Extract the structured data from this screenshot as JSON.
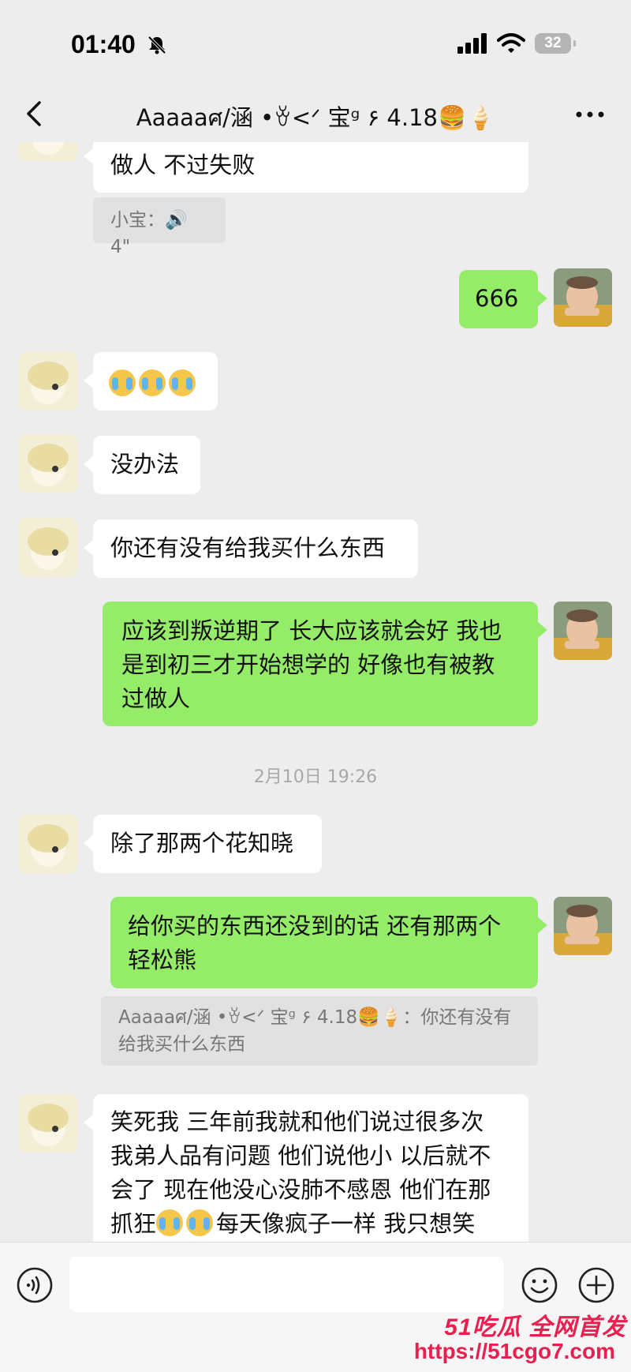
{
  "status_bar": {
    "time": "01:40",
    "battery": "32"
  },
  "header": {
    "title": "Aaaaaศ/涵 •ꈊ<ᐟ 宝ᵍ ۶ 4.18🍔🍦"
  },
  "messages": [
    {
      "dir": "in",
      "text": "做人 不过失败"
    },
    {
      "dir": "quote",
      "text": "小宝：🔊 4\""
    },
    {
      "dir": "out",
      "text": "666"
    },
    {
      "dir": "in",
      "emoji": [
        "crying-emoji",
        "crying-emoji",
        "crying-emoji"
      ]
    },
    {
      "dir": "in",
      "text": "没办法"
    },
    {
      "dir": "in",
      "text": "你还有没有给我买什么东西"
    },
    {
      "dir": "out",
      "lines": [
        "应该到叛逆期了 长大应该就会好 我也",
        "是到初三才开始想学的 好像也有被教",
        "过做人"
      ]
    },
    {
      "dir": "time",
      "text": "2月10日 19:26"
    },
    {
      "dir": "in",
      "text": "除了那两个花知晓"
    },
    {
      "dir": "out",
      "lines": [
        "给你买的东西还没到的话 还有那两个",
        "轻松熊"
      ]
    },
    {
      "dir": "quote",
      "lines": [
        "Aaaaaศ/涵 •ꈊ<ᐟ 宝ᵍ ۶ 4.18🍔🍦：你还有没有",
        "给我买什么东西"
      ]
    },
    {
      "dir": "in",
      "lines": [
        "笑死我 三年前我就和他们说过很多次",
        "我弟人品有问题 他们说他小 以后就不",
        "会了 现在他没心没肺不感恩 他们在那",
        "每天像疯子一样 我只想笑"
      ],
      "line4_prefix": "抓狂"
    }
  ],
  "input": {
    "placeholder": ""
  },
  "watermark": {
    "brand": "51吃瓜 全网首发",
    "url": "https://51cgo7.com"
  },
  "colors": {
    "out_bubble": "#95ec69",
    "in_bubble": "#ffffff",
    "background": "#ededed",
    "watermark": "#e8204f"
  }
}
